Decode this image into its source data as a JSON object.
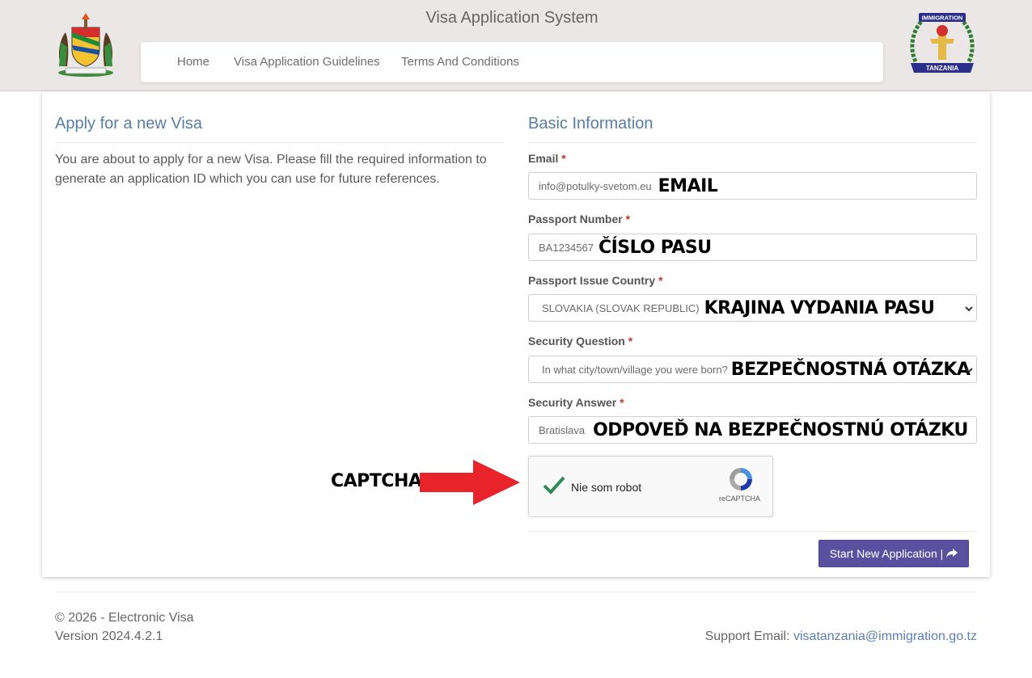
{
  "header": {
    "site_title": "Visa Application System",
    "nav": [
      {
        "label": "Home"
      },
      {
        "label": "Visa Application Guidelines"
      },
      {
        "label": "Terms And Conditions"
      }
    ],
    "immigration_logo_text": [
      "IMMIGRATION",
      "TANZANIA"
    ]
  },
  "left": {
    "title": "Apply for a new Visa",
    "intro": "You are about to apply for a new Visa. Please fill the required information to generate an application ID which you can use for future references."
  },
  "form": {
    "title": "Basic Information",
    "required_marker": "*",
    "fields": [
      {
        "label": "Email",
        "value": "info@potulky-svetom.eu",
        "annotation": "EMAIL",
        "type": "input"
      },
      {
        "label": "Passport Number",
        "value": "BA1234567",
        "annotation": "ČÍSLO PASU",
        "type": "input"
      },
      {
        "label": "Passport Issue Country",
        "value": "SLOVAKIA (SLOVAK REPUBLIC)",
        "annotation": "KRAJINA VYDANIA PASU",
        "type": "select"
      },
      {
        "label": "Security Question",
        "value": "In what city/town/village you were born?",
        "annotation": "BEZPEČNOSTNÁ OTÁZKA",
        "type": "select"
      },
      {
        "label": "Security Answer",
        "value": "Bratislava",
        "annotation": "ODPOVEĎ NA BEZPEČNOSTNÚ OTÁZKU",
        "type": "input"
      }
    ],
    "captcha": {
      "label": "Nie som robot",
      "brand": "reCAPTCHA",
      "checked": true,
      "annotation": "CAPTCHA"
    },
    "submit_label": "Start New Application |"
  },
  "footer": {
    "copyright": "© 2026 - Electronic Visa",
    "version": "Version 2024.4.2.1",
    "support_label": "Support Email:",
    "support_email": "visatanzania@immigration.go.tz"
  },
  "colors": {
    "accent": "#587ea3",
    "button": "#5b50a0",
    "required": "#c0392b",
    "annotation_arrow": "#e8232a",
    "check": "#2e8b57"
  }
}
